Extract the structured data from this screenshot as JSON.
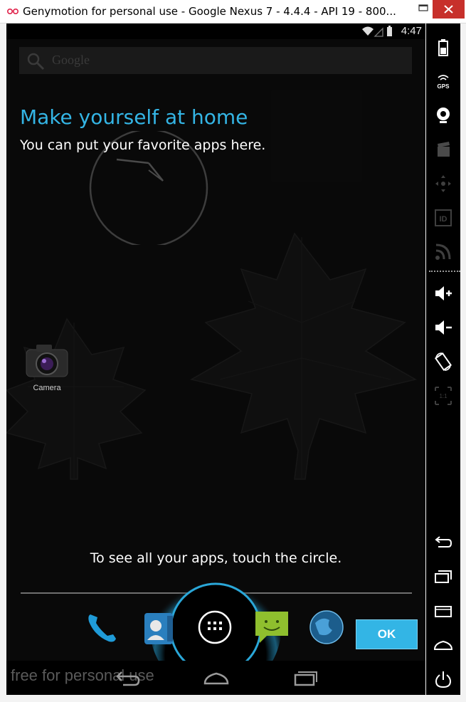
{
  "window": {
    "title": "Genymotion for personal use - Google Nexus 7 - 4.4.4 - API 19 - 800...",
    "close_color": "#c7302b"
  },
  "statusbar": {
    "time": "4:47",
    "icons": [
      "wifi-icon",
      "signal-icon",
      "battery-icon"
    ]
  },
  "search": {
    "label": "Google"
  },
  "cling": {
    "title": "Make yourself at home",
    "body": "You can put your favorite apps here.",
    "hint": "To see all your apps, touch the circle.",
    "ok_label": "OK",
    "accent_color": "#33b5e5"
  },
  "desktop": {
    "apps": [
      {
        "label": "Camera",
        "icon": "camera-icon"
      }
    ]
  },
  "dock": {
    "icons": [
      "phone-icon",
      "contacts-icon",
      "all-apps-icon",
      "messaging-icon",
      "browser-icon"
    ]
  },
  "navbar": {
    "watermark": "free for personal use",
    "buttons": [
      "back-icon",
      "home-icon",
      "recent-apps-icon"
    ]
  },
  "sidebar": {
    "tools": [
      "battery-icon",
      "gps-icon",
      "webcam-icon",
      "capture-icon",
      "dpad-icon",
      "id-icon",
      "rss-icon",
      "volume-up-icon",
      "volume-down-icon",
      "rotate-icon",
      "pixel-perfect-icon",
      "back-icon",
      "recent-apps-icon",
      "menu-icon",
      "home-icon",
      "power-icon"
    ],
    "gps_label": "GPS",
    "id_label": "ID",
    "ratio_label": "1:1"
  }
}
